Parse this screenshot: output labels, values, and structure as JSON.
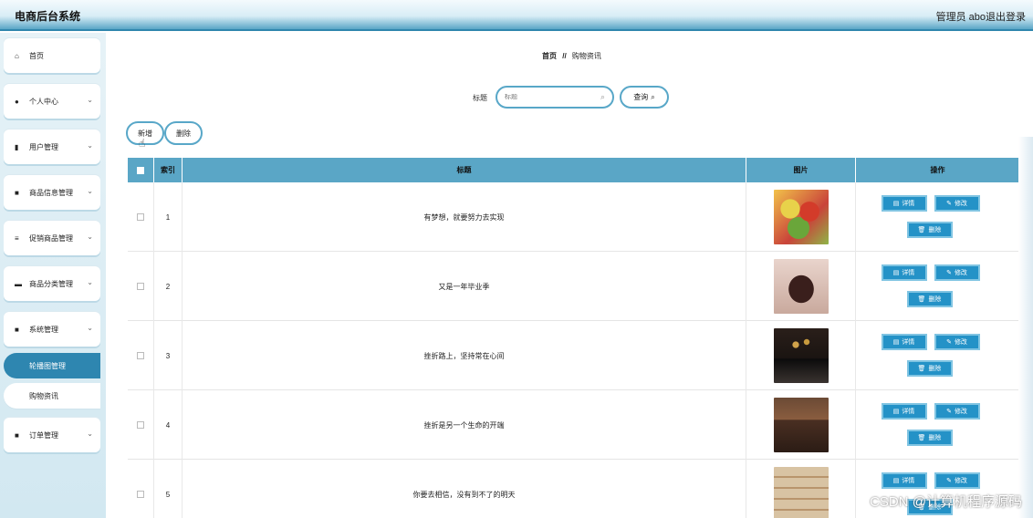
{
  "header": {
    "title": "电商后台系统",
    "user": "管理员 abo",
    "logout": "退出登录"
  },
  "sidebar": {
    "items": [
      {
        "label": "首页",
        "icon": "home-icon",
        "glyph": "⌂",
        "expandable": false
      },
      {
        "label": "个人中心",
        "icon": "user-icon",
        "glyph": "●",
        "expandable": true
      },
      {
        "label": "用户管理",
        "icon": "users-icon",
        "glyph": "▮",
        "expandable": true
      },
      {
        "label": "商品信息管理",
        "icon": "grid-icon",
        "glyph": "■",
        "expandable": true
      },
      {
        "label": "促销商品管理",
        "icon": "list-icon",
        "glyph": "≡",
        "expandable": true
      },
      {
        "label": "商品分类管理",
        "icon": "tag-icon",
        "glyph": "▬",
        "expandable": true
      },
      {
        "label": "系统管理",
        "icon": "grid-icon",
        "glyph": "■",
        "expandable": true
      },
      {
        "label": "订单管理",
        "icon": "grid-icon",
        "glyph": "■",
        "expandable": true
      }
    ],
    "sub_items": [
      "轮播图管理",
      "购物资讯"
    ],
    "chevron": "⌄"
  },
  "breadcrumb": {
    "home": "首页",
    "separator": "//",
    "current": "购物资讯"
  },
  "search": {
    "label": "标题",
    "placeholder": "标题",
    "button": "查询",
    "icon": "search-icon"
  },
  "toolbar": {
    "add": "新增",
    "delete": "删除"
  },
  "table": {
    "headers": {
      "index": "索引",
      "title": "标题",
      "image": "图片",
      "actions": "操作"
    },
    "actions": {
      "detail": "详情",
      "edit": "修改",
      "delete": "删除"
    },
    "rows": [
      {
        "index": "1",
        "title": "有梦想，就要努力去实现",
        "image_desc": "fruit"
      },
      {
        "index": "2",
        "title": "又是一年毕业季",
        "image_desc": "handbag"
      },
      {
        "index": "3",
        "title": "挫折路上，坚持常在心间",
        "image_desc": "dark-display"
      },
      {
        "index": "4",
        "title": "挫折是另一个生命的开端",
        "image_desc": "furniture-room"
      },
      {
        "index": "5",
        "title": "你要去相信，没有到不了的明天",
        "image_desc": "wood-shelves"
      }
    ]
  },
  "watermark": "CSDN @计算机程序源码",
  "colors": {
    "accent": "#2492c7",
    "header_row": "#5aa6c6",
    "sidebar_active": "#2e86b0"
  }
}
